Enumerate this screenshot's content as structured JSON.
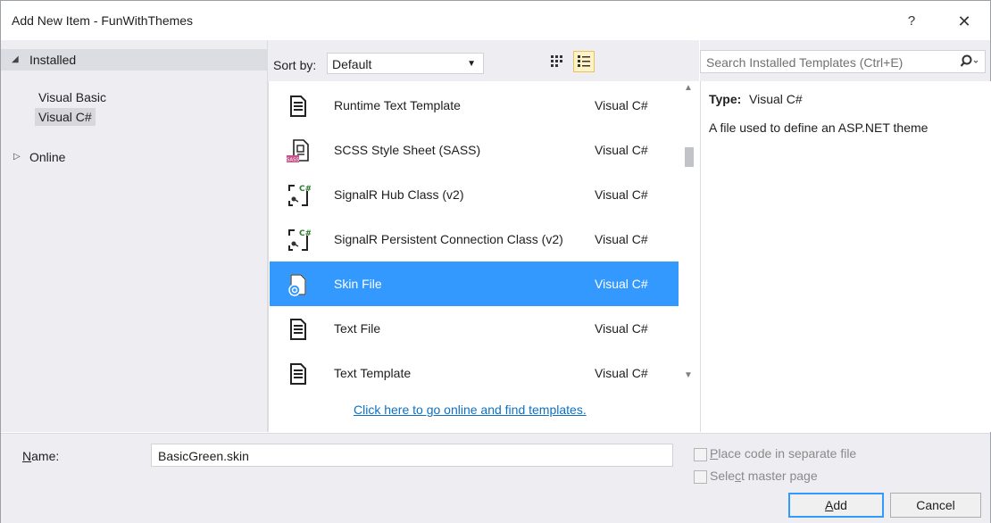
{
  "window": {
    "title": "Add New Item - FunWithThemes",
    "help_label": "?",
    "close_label": "✕"
  },
  "left_pane": {
    "installed_label": "Installed",
    "installed_items": [
      "Visual Basic",
      "Visual C#"
    ],
    "online_label": "Online"
  },
  "toolbar": {
    "sort_label": "Sort by:",
    "sort_value": "Default"
  },
  "templates": [
    {
      "name": "Runtime Text Template",
      "lang": "Visual C#",
      "icon": "text-template-icon"
    },
    {
      "name": "SCSS Style Sheet (SASS)",
      "lang": "Visual C#",
      "icon": "scss-stylesheet-icon"
    },
    {
      "name": "SignalR Hub Class (v2)",
      "lang": "Visual C#",
      "icon": "signalr-hub-icon"
    },
    {
      "name": "SignalR Persistent Connection Class (v2)",
      "lang": "Visual C#",
      "icon": "signalr-connection-icon"
    },
    {
      "name": "Skin File",
      "lang": "Visual C#",
      "icon": "skin-file-icon",
      "selected": true
    },
    {
      "name": "Text File",
      "lang": "Visual C#",
      "icon": "text-file-icon"
    },
    {
      "name": "Text Template",
      "lang": "Visual C#",
      "icon": "text-template-icon"
    }
  ],
  "online_link": "Click here to go online and find templates.",
  "search": {
    "placeholder": "Search Installed Templates (Ctrl+E)"
  },
  "details": {
    "type_label": "Type:",
    "type_value": "Visual C#",
    "description": "A file used to define an ASP.NET theme"
  },
  "bottom": {
    "name_label_prefix": "N",
    "name_label_rest": "ame:",
    "name_value": "BasicGreen.skin",
    "place_code_prefix": "P",
    "place_code_rest": "lace code in separate file",
    "master_prefix": "Sele",
    "master_mnemonic": "c",
    "master_rest": "t master page",
    "add_prefix": "A",
    "add_rest": "dd",
    "cancel_label": "Cancel"
  },
  "colors": {
    "selection": "#3399ff",
    "link": "#0e70c0",
    "pane_bg": "#eeeef2"
  }
}
